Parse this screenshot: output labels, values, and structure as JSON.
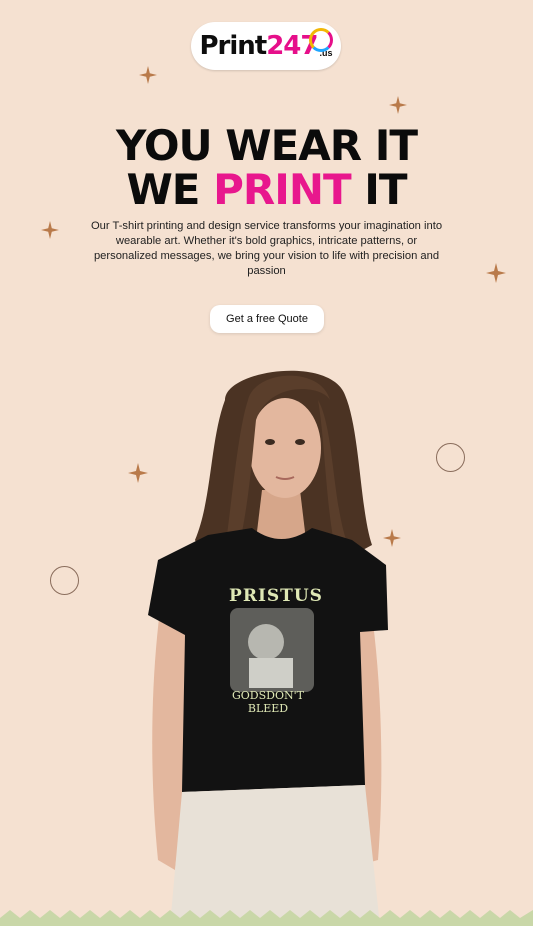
{
  "logo": {
    "brand": "Print",
    "brand_accent": "247",
    "suffix": ".us"
  },
  "hero": {
    "headline_line1": "YOU WEAR IT",
    "headline_line2_prefix": "WE ",
    "headline_line2_accent": "PRINT",
    "headline_line2_suffix": " IT",
    "description": "Our T-shirt printing and design service transforms your imagination into wearable art. Whether it's bold graphics, intricate patterns, or personalized messages, we bring your vision to life with precision and passion",
    "cta_label": "Get a free Quote"
  },
  "tshirt_print": {
    "top_text": "PRISTUS",
    "caption_line1": "GODSDON'T",
    "caption_line2": "BLEED"
  },
  "colors": {
    "background": "#f5e1d1",
    "accent": "#e8178d",
    "decor": "#b97a4a",
    "footer_zigzag": "#c9d7a8"
  },
  "icons": {
    "sparkle": "four-point-star-icon",
    "ring": "circle-outline-icon"
  }
}
